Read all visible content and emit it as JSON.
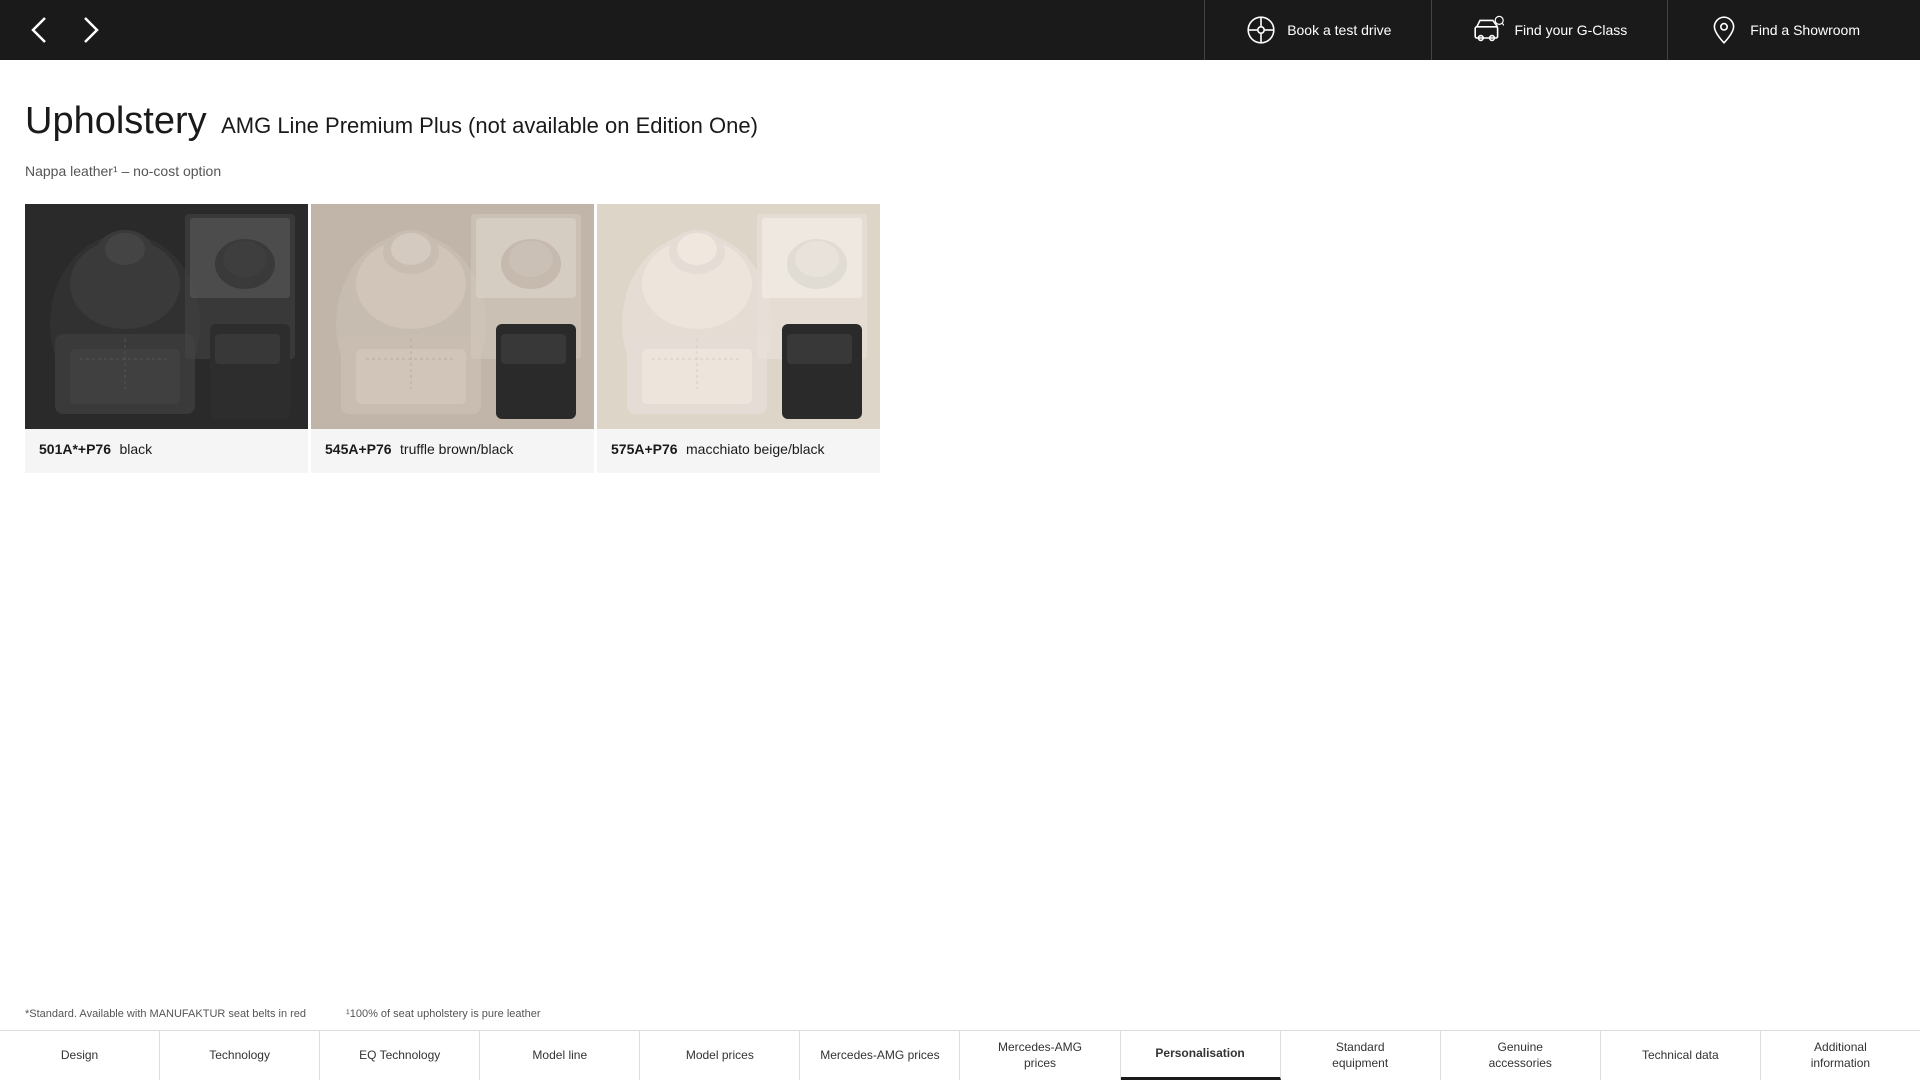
{
  "header": {
    "book_test_drive": "Book a test drive",
    "find_g_class": "Find your G-Class",
    "find_showroom": "Find a Showroom"
  },
  "page": {
    "title": "Upholstery",
    "subtitle": "AMG Line Premium Plus (not available on Edition One)",
    "note": "Nappa leather¹ – no-cost option"
  },
  "cards": [
    {
      "code": "501A*+P76",
      "name": "black",
      "image_type": "black"
    },
    {
      "code": "545A+P76",
      "name": "truffle brown/black",
      "image_type": "truffle"
    },
    {
      "code": "575A+P76",
      "name": "macchiato beige/black",
      "image_type": "beige"
    }
  ],
  "footnotes": [
    "*Standard. Available with MANUFAKTUR seat belts in red",
    "¹100% of seat upholstery is pure leather"
  ],
  "bottom_nav": [
    {
      "label": "Design",
      "active": false
    },
    {
      "label": "Technology",
      "active": false
    },
    {
      "label": "EQ Technology",
      "active": false
    },
    {
      "label": "Model line",
      "active": false
    },
    {
      "label": "Model prices",
      "active": false
    },
    {
      "label": "Mercedes-AMG prices",
      "active": false
    },
    {
      "label": "Mercedes-AMG prices",
      "active": false
    },
    {
      "label": "Personalisation",
      "active": true
    },
    {
      "label": "Standard equipment",
      "active": false
    },
    {
      "label": "Genuine accessories",
      "active": false
    },
    {
      "label": "Technical data",
      "active": false
    },
    {
      "label": "Additional information",
      "active": false
    }
  ]
}
